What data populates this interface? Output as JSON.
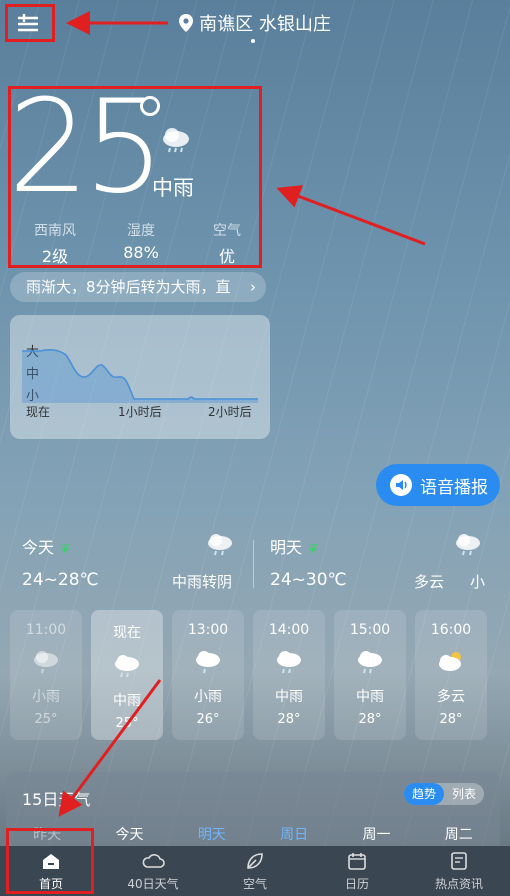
{
  "header": {
    "location": "南谯区 水银山庄"
  },
  "current": {
    "temperature": "25",
    "condition": "中雨",
    "stats": [
      {
        "label": "西南风",
        "value": "2级"
      },
      {
        "label": "湿度",
        "value": "88%"
      },
      {
        "label": "空气",
        "value": "优"
      }
    ]
  },
  "notice": {
    "text": "雨渐大，8分钟后转为大雨，直"
  },
  "precip": {
    "levels": [
      "大",
      "中",
      "小"
    ],
    "ticks": [
      "现在",
      "1小时后",
      "2小时后"
    ]
  },
  "voice": {
    "label": "语音播报"
  },
  "today": {
    "label": "今天",
    "temp": "24~28℃",
    "condition": "中雨转阴"
  },
  "tomorrow": {
    "label": "明天",
    "temp": "24~30℃",
    "condition": "多云",
    "condition_tail": "小"
  },
  "hours": [
    {
      "time": "11:00",
      "cond": "小雨",
      "temp": "25°"
    },
    {
      "time": "现在",
      "cond": "中雨",
      "temp": "25°"
    },
    {
      "time": "13:00",
      "cond": "小雨",
      "temp": "26°"
    },
    {
      "time": "14:00",
      "cond": "中雨",
      "temp": "28°"
    },
    {
      "time": "15:00",
      "cond": "中雨",
      "temp": "28°"
    },
    {
      "time": "16:00",
      "cond": "多云",
      "temp": "28°"
    }
  ],
  "fifteen": {
    "title": "15日天气",
    "toggle": [
      "趋势",
      "列表"
    ],
    "days": [
      "昨天",
      "今天",
      "明天",
      "周日",
      "周一",
      "周二"
    ]
  },
  "nav": [
    "首页",
    "40日天气",
    "空气",
    "日历",
    "热点资讯"
  ],
  "colors": {
    "accent": "#2a8cf0",
    "annotation": "#e02020",
    "leaf": "#3ecf6a"
  }
}
